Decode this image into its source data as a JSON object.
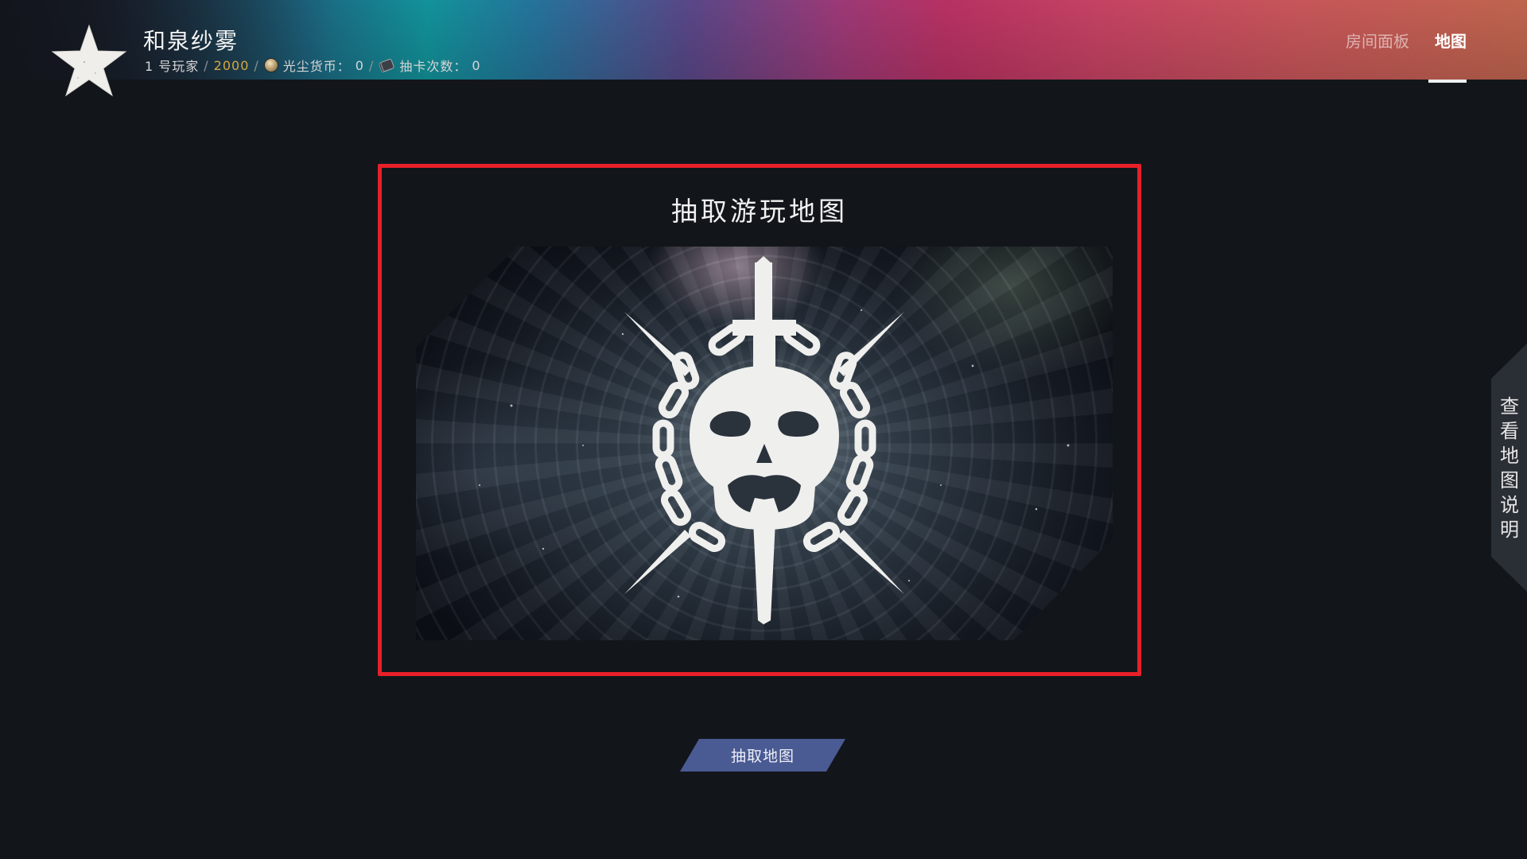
{
  "header": {
    "player_name": "和泉纱雾",
    "player_slot": "1 号玩家",
    "separator": "/",
    "score": "2000",
    "dust_label": "光尘货币：",
    "dust_value": "0",
    "draws_label": "抽卡次数：",
    "draws_value": "0",
    "nav": [
      {
        "label": "房间面板",
        "active": false
      },
      {
        "label": "地图",
        "active": true
      }
    ]
  },
  "panel": {
    "title": "抽取游玩地图",
    "border_color": "#e8202a"
  },
  "draw_button": {
    "label": "抽取地图",
    "color": "#4a5a93"
  },
  "side_tab": {
    "label": "查看地图说明"
  },
  "icons": {
    "emblem": "star-emblem-icon",
    "dust": "coin-icon",
    "draws": "card-deck-icon",
    "map_art": "skull-sword-chains-emblem"
  }
}
